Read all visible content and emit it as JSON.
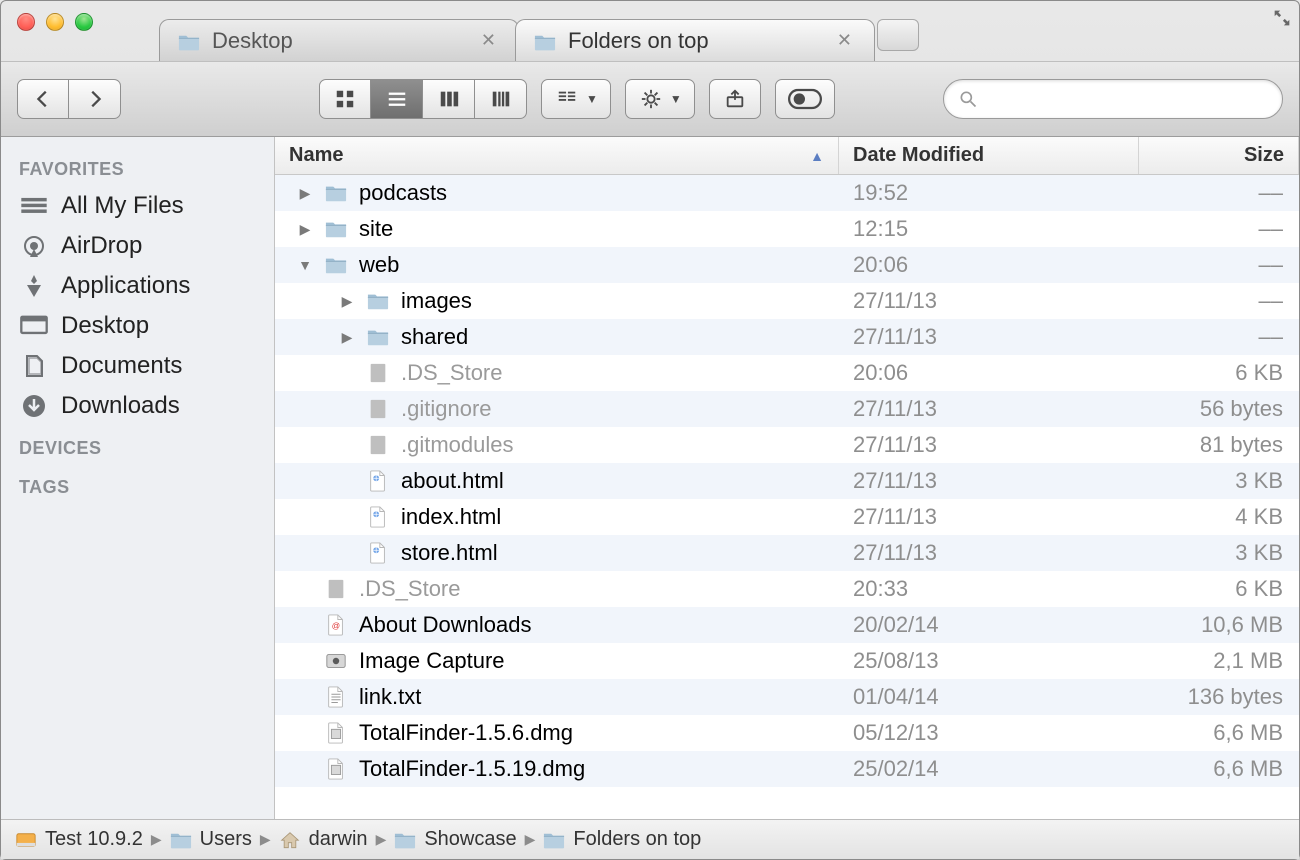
{
  "window": {
    "tabs": [
      {
        "label": "Desktop",
        "active": false
      },
      {
        "label": "Folders on top",
        "active": true
      }
    ]
  },
  "toolbar": {
    "search_placeholder": ""
  },
  "sidebar": {
    "sections": [
      {
        "title": "FAVORITES",
        "items": [
          {
            "icon": "all-my-files-icon",
            "label": "All My Files"
          },
          {
            "icon": "airdrop-icon",
            "label": "AirDrop"
          },
          {
            "icon": "applications-icon",
            "label": "Applications"
          },
          {
            "icon": "desktop-icon",
            "label": "Desktop"
          },
          {
            "icon": "documents-icon",
            "label": "Documents"
          },
          {
            "icon": "downloads-icon",
            "label": "Downloads"
          }
        ]
      },
      {
        "title": "DEVICES",
        "items": []
      },
      {
        "title": "TAGS",
        "items": []
      }
    ]
  },
  "columns": {
    "name": "Name",
    "date": "Date Modified",
    "size": "Size"
  },
  "rows": [
    {
      "indent": 0,
      "arrow": "right",
      "kind": "folder",
      "name": "podcasts",
      "date": "19:52",
      "size": "––"
    },
    {
      "indent": 0,
      "arrow": "right",
      "kind": "folder",
      "name": "site",
      "date": "12:15",
      "size": "––"
    },
    {
      "indent": 0,
      "arrow": "down",
      "kind": "folder",
      "name": "web",
      "date": "20:06",
      "size": "––"
    },
    {
      "indent": 1,
      "arrow": "right",
      "kind": "folder",
      "name": "images",
      "date": "27/11/13",
      "size": "––"
    },
    {
      "indent": 1,
      "arrow": "right",
      "kind": "folder",
      "name": "shared",
      "date": "27/11/13",
      "size": "––"
    },
    {
      "indent": 1,
      "arrow": "",
      "kind": "file",
      "name": ".DS_Store",
      "date": "20:06",
      "size": "6 KB",
      "dim": true
    },
    {
      "indent": 1,
      "arrow": "",
      "kind": "file",
      "name": ".gitignore",
      "date": "27/11/13",
      "size": "56 bytes",
      "dim": true
    },
    {
      "indent": 1,
      "arrow": "",
      "kind": "file",
      "name": ".gitmodules",
      "date": "27/11/13",
      "size": "81 bytes",
      "dim": true
    },
    {
      "indent": 1,
      "arrow": "",
      "kind": "html",
      "name": "about.html",
      "date": "27/11/13",
      "size": "3 KB"
    },
    {
      "indent": 1,
      "arrow": "",
      "kind": "html",
      "name": "index.html",
      "date": "27/11/13",
      "size": "4 KB"
    },
    {
      "indent": 1,
      "arrow": "",
      "kind": "html",
      "name": "store.html",
      "date": "27/11/13",
      "size": "3 KB"
    },
    {
      "indent": 0,
      "arrow": "",
      "kind": "file",
      "name": ".DS_Store",
      "date": "20:33",
      "size": "6 KB",
      "dim": true
    },
    {
      "indent": 0,
      "arrow": "",
      "kind": "webloc",
      "name": "About Downloads",
      "date": "20/02/14",
      "size": "10,6 MB"
    },
    {
      "indent": 0,
      "arrow": "",
      "kind": "app",
      "name": "Image Capture",
      "date": "25/08/13",
      "size": "2,1 MB"
    },
    {
      "indent": 0,
      "arrow": "",
      "kind": "txt",
      "name": "link.txt",
      "date": "01/04/14",
      "size": "136 bytes"
    },
    {
      "indent": 0,
      "arrow": "",
      "kind": "dmg",
      "name": "TotalFinder-1.5.6.dmg",
      "date": "05/12/13",
      "size": "6,6 MB"
    },
    {
      "indent": 0,
      "arrow": "",
      "kind": "dmg",
      "name": "TotalFinder-1.5.19.dmg",
      "date": "25/02/14",
      "size": "6,6 MB"
    }
  ],
  "pathbar": [
    {
      "icon": "disk",
      "label": "Test 10.9.2"
    },
    {
      "icon": "folder",
      "label": "Users"
    },
    {
      "icon": "home",
      "label": "darwin"
    },
    {
      "icon": "folder",
      "label": "Showcase"
    },
    {
      "icon": "folder",
      "label": "Folders on top"
    }
  ]
}
